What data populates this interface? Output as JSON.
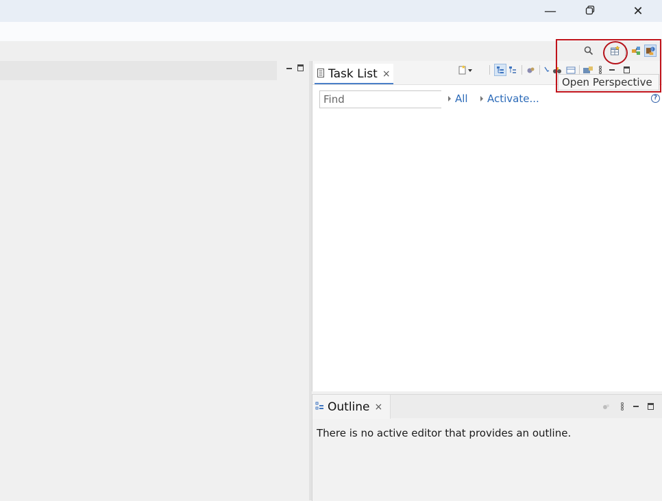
{
  "window": {
    "minimize_glyph": "—",
    "restore_glyph": "❐",
    "close_glyph": "✕"
  },
  "toolbar": {
    "icons": [
      "search-icon",
      "open-perspective-icon",
      "java-ee-perspective-icon",
      "java-perspective-icon"
    ]
  },
  "tooltip": {
    "text": "Open Perspective"
  },
  "task_list": {
    "tab_label": "Task List",
    "close_glyph": "×",
    "find_placeholder": "Find",
    "filter_all": "All",
    "filter_activate": "Activate...",
    "help_glyph": "?"
  },
  "outline": {
    "tab_label": "Outline",
    "close_glyph": "×",
    "message": "There is no active editor that provides an outline."
  },
  "colors": {
    "accent": "#2b6ab8",
    "highlight": "#c0121a"
  }
}
